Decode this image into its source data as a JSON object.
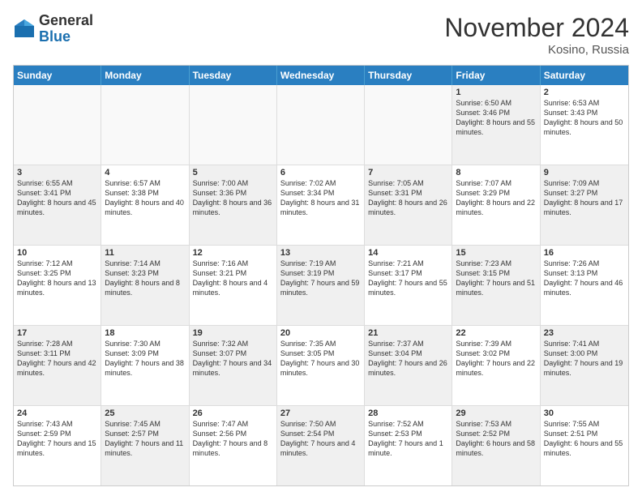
{
  "logo": {
    "general": "General",
    "blue": "Blue"
  },
  "header": {
    "month": "November 2024",
    "location": "Kosino, Russia"
  },
  "days_of_week": [
    "Sunday",
    "Monday",
    "Tuesday",
    "Wednesday",
    "Thursday",
    "Friday",
    "Saturday"
  ],
  "rows": [
    [
      {
        "day": "",
        "info": "",
        "shaded": false,
        "empty": true
      },
      {
        "day": "",
        "info": "",
        "shaded": false,
        "empty": true
      },
      {
        "day": "",
        "info": "",
        "shaded": false,
        "empty": true
      },
      {
        "day": "",
        "info": "",
        "shaded": false,
        "empty": true
      },
      {
        "day": "",
        "info": "",
        "shaded": false,
        "empty": true
      },
      {
        "day": "1",
        "info": "Sunrise: 6:50 AM\nSunset: 3:46 PM\nDaylight: 8 hours and 55 minutes.",
        "shaded": true,
        "empty": false
      },
      {
        "day": "2",
        "info": "Sunrise: 6:53 AM\nSunset: 3:43 PM\nDaylight: 8 hours and 50 minutes.",
        "shaded": false,
        "empty": false
      }
    ],
    [
      {
        "day": "3",
        "info": "Sunrise: 6:55 AM\nSunset: 3:41 PM\nDaylight: 8 hours and 45 minutes.",
        "shaded": true,
        "empty": false
      },
      {
        "day": "4",
        "info": "Sunrise: 6:57 AM\nSunset: 3:38 PM\nDaylight: 8 hours and 40 minutes.",
        "shaded": false,
        "empty": false
      },
      {
        "day": "5",
        "info": "Sunrise: 7:00 AM\nSunset: 3:36 PM\nDaylight: 8 hours and 36 minutes.",
        "shaded": true,
        "empty": false
      },
      {
        "day": "6",
        "info": "Sunrise: 7:02 AM\nSunset: 3:34 PM\nDaylight: 8 hours and 31 minutes.",
        "shaded": false,
        "empty": false
      },
      {
        "day": "7",
        "info": "Sunrise: 7:05 AM\nSunset: 3:31 PM\nDaylight: 8 hours and 26 minutes.",
        "shaded": true,
        "empty": false
      },
      {
        "day": "8",
        "info": "Sunrise: 7:07 AM\nSunset: 3:29 PM\nDaylight: 8 hours and 22 minutes.",
        "shaded": false,
        "empty": false
      },
      {
        "day": "9",
        "info": "Sunrise: 7:09 AM\nSunset: 3:27 PM\nDaylight: 8 hours and 17 minutes.",
        "shaded": true,
        "empty": false
      }
    ],
    [
      {
        "day": "10",
        "info": "Sunrise: 7:12 AM\nSunset: 3:25 PM\nDaylight: 8 hours and 13 minutes.",
        "shaded": false,
        "empty": false
      },
      {
        "day": "11",
        "info": "Sunrise: 7:14 AM\nSunset: 3:23 PM\nDaylight: 8 hours and 8 minutes.",
        "shaded": true,
        "empty": false
      },
      {
        "day": "12",
        "info": "Sunrise: 7:16 AM\nSunset: 3:21 PM\nDaylight: 8 hours and 4 minutes.",
        "shaded": false,
        "empty": false
      },
      {
        "day": "13",
        "info": "Sunrise: 7:19 AM\nSunset: 3:19 PM\nDaylight: 7 hours and 59 minutes.",
        "shaded": true,
        "empty": false
      },
      {
        "day": "14",
        "info": "Sunrise: 7:21 AM\nSunset: 3:17 PM\nDaylight: 7 hours and 55 minutes.",
        "shaded": false,
        "empty": false
      },
      {
        "day": "15",
        "info": "Sunrise: 7:23 AM\nSunset: 3:15 PM\nDaylight: 7 hours and 51 minutes.",
        "shaded": true,
        "empty": false
      },
      {
        "day": "16",
        "info": "Sunrise: 7:26 AM\nSunset: 3:13 PM\nDaylight: 7 hours and 46 minutes.",
        "shaded": false,
        "empty": false
      }
    ],
    [
      {
        "day": "17",
        "info": "Sunrise: 7:28 AM\nSunset: 3:11 PM\nDaylight: 7 hours and 42 minutes.",
        "shaded": true,
        "empty": false
      },
      {
        "day": "18",
        "info": "Sunrise: 7:30 AM\nSunset: 3:09 PM\nDaylight: 7 hours and 38 minutes.",
        "shaded": false,
        "empty": false
      },
      {
        "day": "19",
        "info": "Sunrise: 7:32 AM\nSunset: 3:07 PM\nDaylight: 7 hours and 34 minutes.",
        "shaded": true,
        "empty": false
      },
      {
        "day": "20",
        "info": "Sunrise: 7:35 AM\nSunset: 3:05 PM\nDaylight: 7 hours and 30 minutes.",
        "shaded": false,
        "empty": false
      },
      {
        "day": "21",
        "info": "Sunrise: 7:37 AM\nSunset: 3:04 PM\nDaylight: 7 hours and 26 minutes.",
        "shaded": true,
        "empty": false
      },
      {
        "day": "22",
        "info": "Sunrise: 7:39 AM\nSunset: 3:02 PM\nDaylight: 7 hours and 22 minutes.",
        "shaded": false,
        "empty": false
      },
      {
        "day": "23",
        "info": "Sunrise: 7:41 AM\nSunset: 3:00 PM\nDaylight: 7 hours and 19 minutes.",
        "shaded": true,
        "empty": false
      }
    ],
    [
      {
        "day": "24",
        "info": "Sunrise: 7:43 AM\nSunset: 2:59 PM\nDaylight: 7 hours and 15 minutes.",
        "shaded": false,
        "empty": false
      },
      {
        "day": "25",
        "info": "Sunrise: 7:45 AM\nSunset: 2:57 PM\nDaylight: 7 hours and 11 minutes.",
        "shaded": true,
        "empty": false
      },
      {
        "day": "26",
        "info": "Sunrise: 7:47 AM\nSunset: 2:56 PM\nDaylight: 7 hours and 8 minutes.",
        "shaded": false,
        "empty": false
      },
      {
        "day": "27",
        "info": "Sunrise: 7:50 AM\nSunset: 2:54 PM\nDaylight: 7 hours and 4 minutes.",
        "shaded": true,
        "empty": false
      },
      {
        "day": "28",
        "info": "Sunrise: 7:52 AM\nSunset: 2:53 PM\nDaylight: 7 hours and 1 minute.",
        "shaded": false,
        "empty": false
      },
      {
        "day": "29",
        "info": "Sunrise: 7:53 AM\nSunset: 2:52 PM\nDaylight: 6 hours and 58 minutes.",
        "shaded": true,
        "empty": false
      },
      {
        "day": "30",
        "info": "Sunrise: 7:55 AM\nSunset: 2:51 PM\nDaylight: 6 hours and 55 minutes.",
        "shaded": false,
        "empty": false
      }
    ]
  ]
}
